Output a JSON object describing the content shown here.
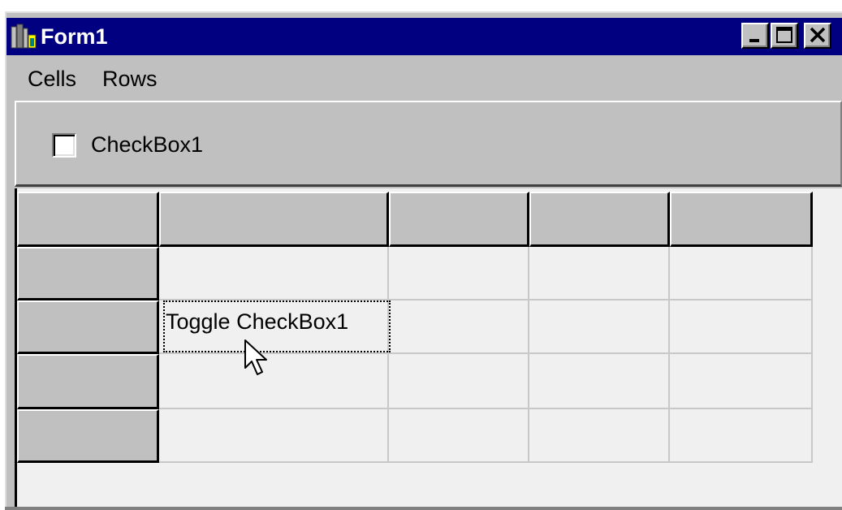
{
  "window": {
    "title": "Form1",
    "app_icon": "app-icon",
    "controls": {
      "minimize_icon": "minimize-icon",
      "maximize_icon": "maximize-icon",
      "close_icon": "close-icon"
    }
  },
  "menu": {
    "items": [
      {
        "label": "Cells"
      },
      {
        "label": "Rows"
      }
    ]
  },
  "panel": {
    "checkbox": {
      "label": "CheckBox1",
      "checked": false
    }
  },
  "grid": {
    "columns": 5,
    "rows": 5,
    "fixed_rows": 1,
    "fixed_cols": 1,
    "cells": [
      [
        "",
        "",
        "",
        "",
        ""
      ],
      [
        "",
        "",
        "",
        "",
        ""
      ],
      [
        "",
        "Toggle CheckBox1",
        "",
        "",
        ""
      ],
      [
        "",
        "",
        "",
        "",
        ""
      ],
      [
        "",
        "",
        "",
        "",
        ""
      ]
    ],
    "focused_cell": {
      "row": 2,
      "col": 1
    }
  },
  "cursor": {
    "icon": "arrow-pointer-icon"
  },
  "colors": {
    "titlebar": "#000080",
    "face": "#c0c0c0",
    "cell_bg": "#f0f0f0",
    "gridline": "#c8c8c8"
  }
}
